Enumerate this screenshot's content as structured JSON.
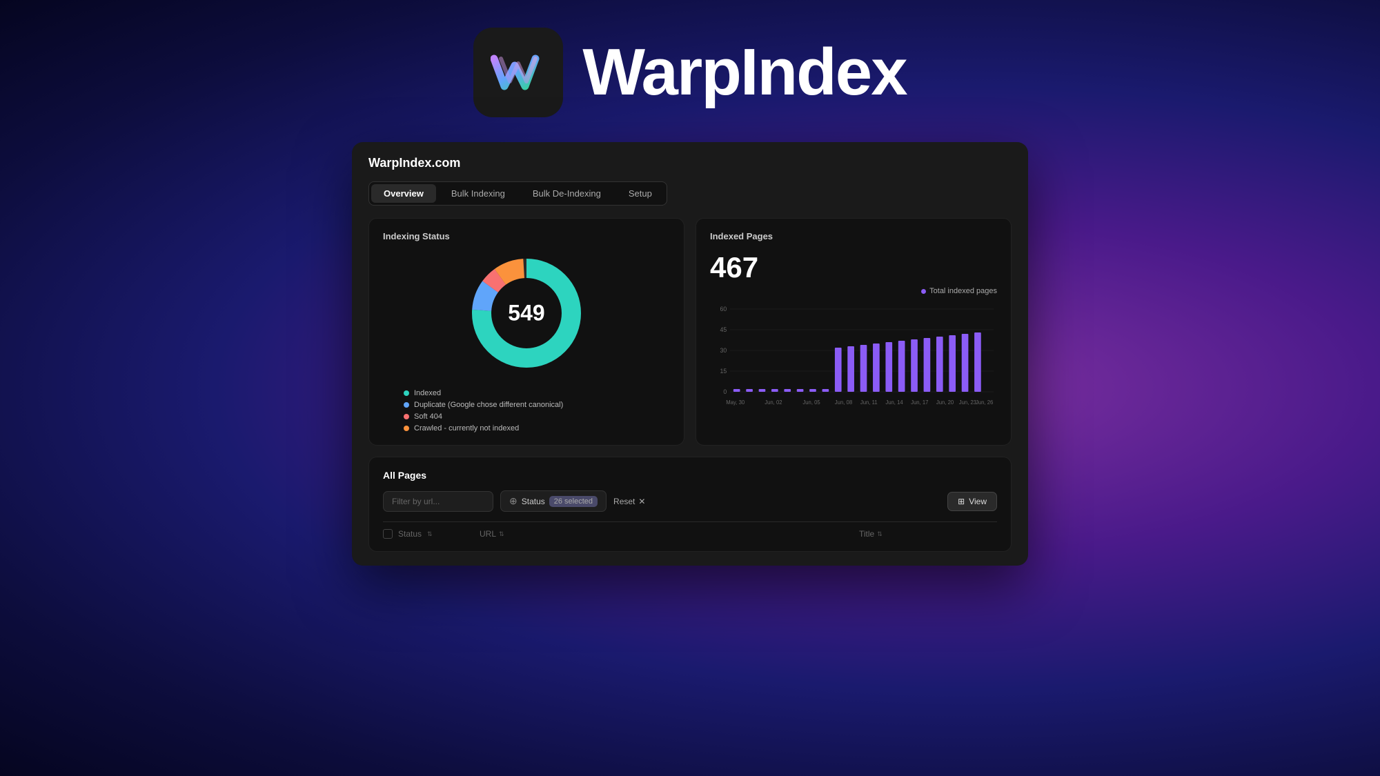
{
  "hero": {
    "app_name": "WarpIndex",
    "icon_alt": "WarpIndex app icon"
  },
  "dashboard": {
    "site_name": "WarpIndex.com",
    "tabs": [
      {
        "label": "Overview",
        "active": true
      },
      {
        "label": "Bulk Indexing",
        "active": false
      },
      {
        "label": "Bulk De-Indexing",
        "active": false
      },
      {
        "label": "Setup",
        "active": false
      }
    ],
    "indexing_status": {
      "title": "Indexing Status",
      "total": "549",
      "segments": [
        {
          "label": "Indexed",
          "color": "#2dd4bf",
          "value": 420,
          "percent": 76
        },
        {
          "label": "Duplicate (Google chose different canonical)",
          "color": "#60a5fa",
          "value": 50,
          "percent": 9
        },
        {
          "label": "Soft 404",
          "color": "#f87171",
          "value": 30,
          "percent": 5
        },
        {
          "label": "Crawled - currently not indexed",
          "color": "#fb923c",
          "value": 49,
          "percent": 9
        }
      ]
    },
    "indexed_pages": {
      "title": "Indexed Pages",
      "count": "467",
      "legend_label": "Total indexed pages",
      "legend_color": "#8b5cf6",
      "x_labels": [
        "May, 30",
        "Jun, 02",
        "Jun, 05",
        "Jun, 08",
        "Jun, 11",
        "Jun, 14",
        "Jun, 17",
        "Jun, 20",
        "Jun, 23",
        "Jun, 26"
      ],
      "y_labels": [
        "60",
        "45",
        "30",
        "15",
        "0"
      ],
      "bars": [
        2,
        2,
        2,
        2,
        2,
        2,
        2,
        2,
        32,
        33,
        34,
        35,
        36,
        37,
        38,
        39,
        40,
        41,
        42,
        43
      ]
    },
    "all_pages": {
      "title": "All Pages",
      "filter_placeholder": "Filter by url...",
      "status_label": "Status",
      "status_count": "26 selected",
      "reset_label": "Reset",
      "view_label": "View",
      "columns": [
        {
          "label": "Status",
          "sortable": true
        },
        {
          "label": "URL",
          "sortable": true
        },
        {
          "label": "Title",
          "sortable": true
        }
      ]
    }
  },
  "colors": {
    "indexed": "#2dd4bf",
    "duplicate": "#60a5fa",
    "soft404": "#f87171",
    "crawled_not_indexed": "#fb923c",
    "bar_color": "#8b5cf6",
    "accent_purple": "#8b5cf6"
  }
}
